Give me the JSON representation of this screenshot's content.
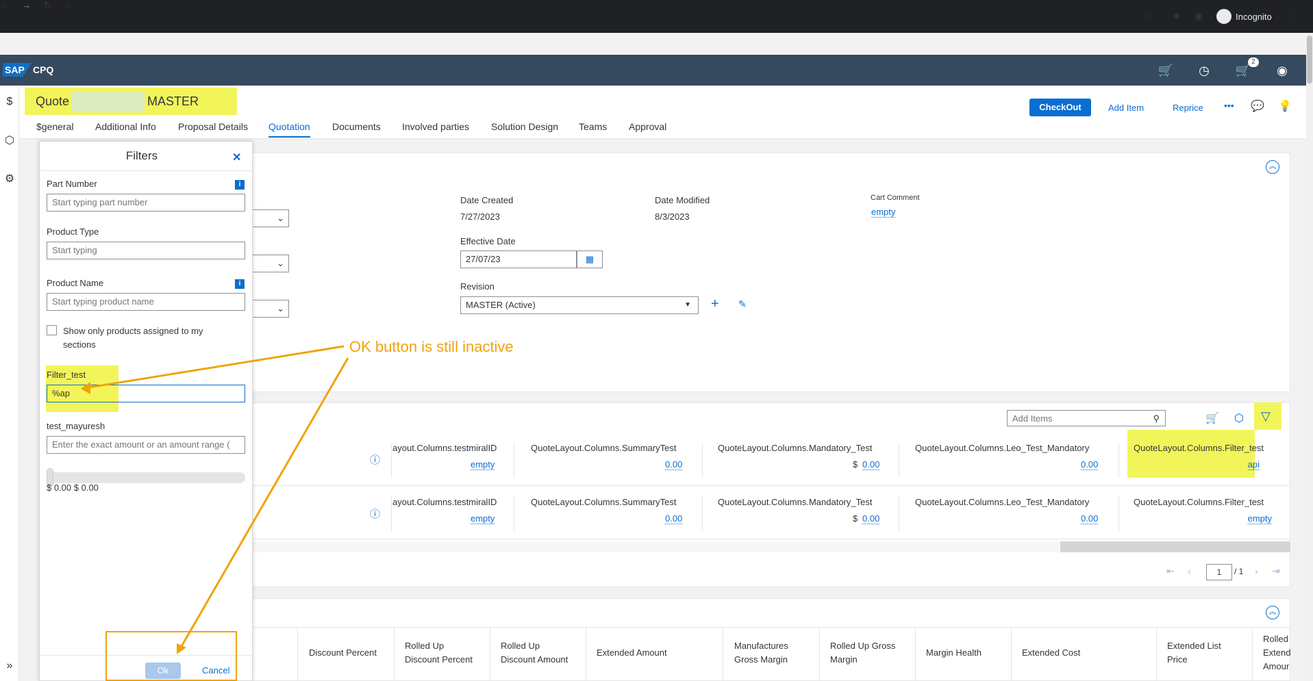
{
  "browser": {
    "nav_icons": [
      "back-arrow",
      "forward-arrow",
      "reload",
      "home"
    ],
    "incognito_label": "Incognito"
  },
  "shell": {
    "brand": "SAP",
    "product": "CPQ",
    "cart_badge": "2"
  },
  "quote": {
    "title_prefix": "Quote",
    "title_suffix": "MASTER"
  },
  "tabs": [
    "$general",
    "Additional Info",
    "Proposal Details",
    "Quotation",
    "Documents",
    "Involved parties",
    "Solution Design",
    "Teams",
    "Approval"
  ],
  "active_tab": "Quotation",
  "header_actions": {
    "checkout": "CheckOut",
    "add_item": "Add Item",
    "reprice": "Reprice",
    "more": "•••"
  },
  "details": {
    "date_created_label": "Date Created",
    "date_created": "7/27/2023",
    "date_modified_label": "Date Modified",
    "date_modified": "8/3/2023",
    "cart_comment_label": "Cart Comment",
    "cart_comment": "empty",
    "effective_date_label": "Effective Date",
    "effective_date": "27/07/23",
    "revision_label": "Revision",
    "revision": "MASTER (Active)"
  },
  "filters": {
    "title": "Filters",
    "part_number_label": "Part Number",
    "part_number_placeholder": "Start typing part number",
    "product_type_label": "Product Type",
    "product_type_placeholder": "Start typing",
    "product_name_label": "Product Name",
    "product_name_placeholder": "Start typing product name",
    "show_only_label_1": "Show only products assigned to my",
    "show_only_label_2": "sections",
    "filter_test_label": "Filter_test",
    "filter_test_value": "%ap",
    "test_mayuresh_label": "test_mayuresh",
    "test_mayuresh_placeholder": "Enter the exact amount or an amount range (",
    "range_text": "$ 0.00 $ 0.00",
    "ok": "Ok",
    "cancel": "Cancel"
  },
  "annotation": "OK button is still inactive",
  "items_toolbar": {
    "add_items_placeholder": "Add Items"
  },
  "item_rows": [
    {
      "cols": [
        {
          "head": "ayout.Columns.testmiralID",
          "value": "empty",
          "currency": ""
        },
        {
          "head": "QuoteLayout.Columns.SummaryTest",
          "value": "0.00",
          "currency": ""
        },
        {
          "head": "QuoteLayout.Columns.Mandatory_Test",
          "value": "0.00",
          "currency": "$"
        },
        {
          "head": "QuoteLayout.Columns.Leo_Test_Mandatory",
          "value": "0.00",
          "currency": ""
        },
        {
          "head": "QuoteLayout.Columns.Filter_test",
          "value": "api",
          "currency": ""
        }
      ]
    },
    {
      "cols": [
        {
          "head": "ayout.Columns.testmiralID",
          "value": "empty",
          "currency": ""
        },
        {
          "head": "QuoteLayout.Columns.SummaryTest",
          "value": "0.00",
          "currency": ""
        },
        {
          "head": "QuoteLayout.Columns.Mandatory_Test",
          "value": "0.00",
          "currency": "$"
        },
        {
          "head": "QuoteLayout.Columns.Leo_Test_Mandatory",
          "value": "0.00",
          "currency": ""
        },
        {
          "head": "QuoteLayout.Columns.Filter_test",
          "value": "empty",
          "currency": ""
        }
      ]
    }
  ],
  "pagination": {
    "page": "1",
    "total": "/ 1"
  },
  "summary_headers": [
    [
      "Discount Percent"
    ],
    [
      "Rolled Up",
      "Discount Percent"
    ],
    [
      "Rolled Up",
      "Discount Amount"
    ],
    [
      "Extended Amount"
    ],
    [
      "Manufactures",
      "Gross Margin"
    ],
    [
      "Rolled Up Gross",
      "Margin"
    ],
    [
      "Margin Health"
    ],
    [
      "Extended Cost"
    ],
    [
      "Extended List",
      "Price"
    ],
    [
      "Rolled",
      "Extend",
      "Amour"
    ]
  ],
  "colors": {
    "shell": "#354a5f",
    "accent": "#0a6ed1",
    "highlight": "#f2f55a",
    "annotation": "#f0a30a"
  }
}
